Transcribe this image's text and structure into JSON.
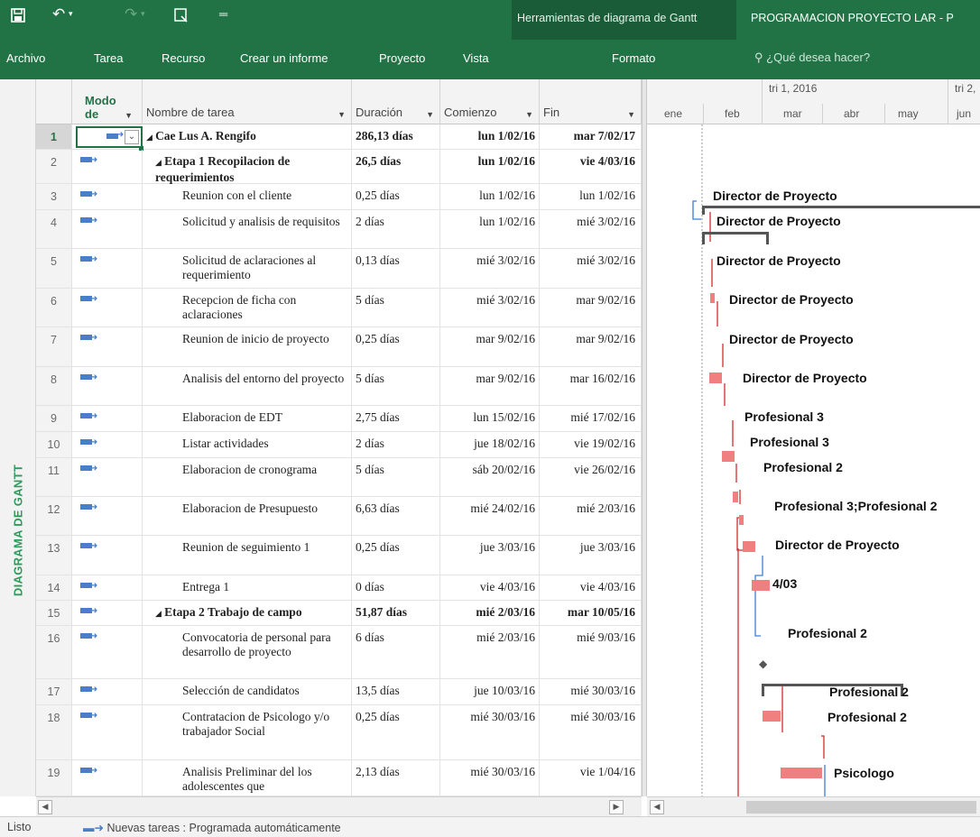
{
  "ribbon": {
    "context_title": "Herramientas de diagrama de Gantt",
    "app_title": "PROGRAMACION PROYECTO LAR - P",
    "tabs": [
      "Archivo",
      "Tarea",
      "Recurso",
      "Crear un informe",
      "Proyecto",
      "Vista"
    ],
    "context_tab": "Formato",
    "tell_me": "¿Qué desea hacer?",
    "brand_color": "#217346"
  },
  "side_label": "DIAGRAMA DE GANTT",
  "columns": {
    "mode": "Modo de",
    "name": "Nombre de tarea",
    "duration": "Duración",
    "start": "Comienzo",
    "finish": "Fin"
  },
  "tasks": [
    {
      "id": "1",
      "name": "Cae Lus A. Rengifo",
      "duration": "286,13 días",
      "start": "lun 1/02/16",
      "finish": "mar 7/02/17",
      "summary": true
    },
    {
      "id": "2",
      "name": "Etapa 1 Recopilacion de requerimientos",
      "duration": "26,5 días",
      "start": "lun 1/02/16",
      "finish": "vie 4/03/16",
      "summary": true
    },
    {
      "id": "3",
      "name": "Reunion con el cliente",
      "duration": "0,25 días",
      "start": "lun 1/02/16",
      "finish": "lun 1/02/16",
      "resource": "Director de Proyecto"
    },
    {
      "id": "4",
      "name": "Solicitud y analisis de requisitos",
      "duration": "2 días",
      "start": "lun 1/02/16",
      "finish": "mié 3/02/16",
      "resource": "Director de Proyecto"
    },
    {
      "id": "5",
      "name": "Solicitud de aclaraciones al requerimiento",
      "duration": "0,13 días",
      "start": "mié 3/02/16",
      "finish": "mié 3/02/16",
      "resource": "Director de Proyecto"
    },
    {
      "id": "6",
      "name": "Recepcion de ficha con aclaraciones",
      "duration": "5 días",
      "start": "mié 3/02/16",
      "finish": "mar 9/02/16",
      "resource": "Director de Proyecto"
    },
    {
      "id": "7",
      "name": "Reunion de inicio de proyecto",
      "duration": "0,25 días",
      "start": "mar 9/02/16",
      "finish": "mar 9/02/16",
      "resource": "Director de Proyecto"
    },
    {
      "id": "8",
      "name": "Analisis del entorno del proyecto",
      "duration": "5 días",
      "start": "mar 9/02/16",
      "finish": "mar 16/02/16",
      "resource": "Director de Proyecto"
    },
    {
      "id": "9",
      "name": "Elaboracion de EDT",
      "duration": "2,75 días",
      "start": "lun 15/02/16",
      "finish": "mié 17/02/16",
      "resource": "Profesional 3"
    },
    {
      "id": "10",
      "name": "Listar actividades",
      "duration": "2 días",
      "start": "jue 18/02/16",
      "finish": "vie 19/02/16",
      "resource": "Profesional 3"
    },
    {
      "id": "11",
      "name": "Elaboracion de cronograma",
      "duration": "5 días",
      "start": "sáb 20/02/16",
      "finish": "vie 26/02/16",
      "resource": "Profesional 2"
    },
    {
      "id": "12",
      "name": "Elaboracion de Presupuesto",
      "duration": "6,63 días",
      "start": "mié 24/02/16",
      "finish": "mié 2/03/16",
      "resource": "Profesional 3;Profesional 2"
    },
    {
      "id": "13",
      "name": "Reunion de seguimiento 1",
      "duration": "0,25 días",
      "start": "jue 3/03/16",
      "finish": "jue 3/03/16",
      "resource": "Director de Proyecto"
    },
    {
      "id": "14",
      "name": "Entrega 1",
      "duration": "0 días",
      "start": "vie 4/03/16",
      "finish": "vie 4/03/16",
      "milestone_label": "4/03"
    },
    {
      "id": "15",
      "name": "Etapa 2 Trabajo de campo",
      "duration": "51,87 días",
      "start": "mié 2/03/16",
      "finish": "mar 10/05/16",
      "summary": true
    },
    {
      "id": "16",
      "name": "Convocatoria de personal para desarrollo de proyecto",
      "duration": "6 días",
      "start": "mié 2/03/16",
      "finish": "mié 9/03/16",
      "resource": "Profesional 2"
    },
    {
      "id": "17",
      "name": "Selección de candidatos",
      "duration": "13,5 días",
      "start": "jue 10/03/16",
      "finish": "mié 30/03/16",
      "resource": "Profesional 2"
    },
    {
      "id": "18",
      "name": "Contratacion de Psicologo y/o trabajador Social",
      "duration": "0,25 días",
      "start": "mié 30/03/16",
      "finish": "mié 30/03/16",
      "resource": "Profesional 2"
    },
    {
      "id": "19",
      "name": "Analisis Preliminar del los adolescentes que",
      "duration": "2,13 días",
      "start": "mié 30/03/16",
      "finish": "vie 1/04/16",
      "resource": "Psicologo"
    }
  ],
  "timescale": {
    "quarters": [
      "tri 1, 2016",
      "tri 2,"
    ],
    "months": [
      "ene",
      "feb",
      "mar",
      "abr",
      "may",
      "jun"
    ]
  },
  "status": {
    "ready": "Listo",
    "mode_text": "Nuevas tareas : Programada automáticamente"
  },
  "colors": {
    "task_bar": "#f08080",
    "link_red": "#d22b2b",
    "link_blue": "#3b7dd8",
    "summary_bracket": "#555555"
  }
}
